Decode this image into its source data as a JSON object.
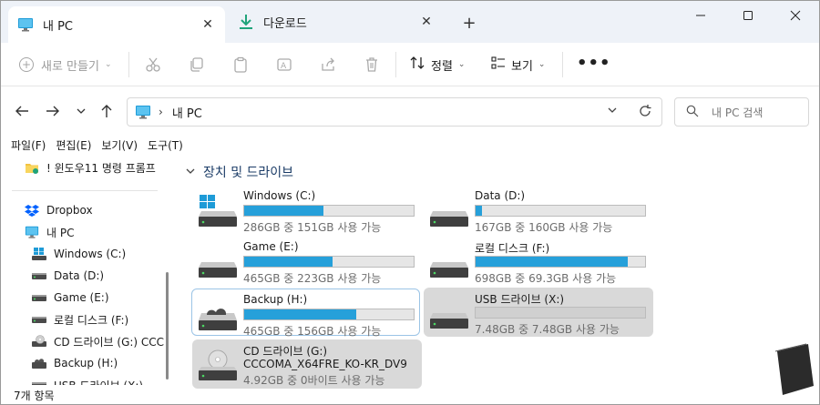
{
  "tabs": [
    {
      "label": "내 PC",
      "icon": "monitor-icon",
      "active": true
    },
    {
      "label": "다운로드",
      "icon": "download-icon",
      "active": false
    }
  ],
  "toolbar": {
    "new_label": "새로 만들기",
    "sort_label": "정렬",
    "view_label": "보기",
    "more_label": "•••"
  },
  "address": {
    "path": "내 PC",
    "separator": "›"
  },
  "search": {
    "placeholder": "내 PC 검색"
  },
  "menubar": [
    "파일(F)",
    "편집(E)",
    "보기(V)",
    "도구(T)"
  ],
  "sidebar": {
    "items": [
      {
        "label": "! 윈도우11 명령 프롬프",
        "icon": "folder-icon"
      },
      {
        "label": "Dropbox",
        "icon": "dropbox-icon"
      },
      {
        "label": "내 PC",
        "icon": "monitor-icon"
      },
      {
        "label": "Windows (C:)",
        "icon": "windows-drive-icon"
      },
      {
        "label": "Data (D:)",
        "icon": "drive-icon"
      },
      {
        "label": "Game (E:)",
        "icon": "drive-icon"
      },
      {
        "label": "로컬 디스크 (F:)",
        "icon": "drive-icon"
      },
      {
        "label": "CD 드라이브 (G:) CCC",
        "icon": "cd-drive-icon"
      },
      {
        "label": "Backup (H:)",
        "icon": "backup-drive-icon"
      },
      {
        "label": "USB 드라이브 (X:)",
        "icon": "usb-drive-icon"
      }
    ]
  },
  "section": {
    "title": "장치 및 드라이브"
  },
  "drives": [
    {
      "name": "Windows (C:)",
      "info": "286GB 중 151GB 사용 가능",
      "used_fraction": 0.47,
      "icon": "windows-drive-icon"
    },
    {
      "name": "Data (D:)",
      "info": "167GB 중 160GB 사용 가능",
      "used_fraction": 0.04,
      "icon": "drive-icon"
    },
    {
      "name": "Game (E:)",
      "info": "465GB 중 223GB 사용 가능",
      "used_fraction": 0.52,
      "icon": "drive-icon"
    },
    {
      "name": "로컬 디스크 (F:)",
      "info": "698GB 중 69.3GB 사용 가능",
      "used_fraction": 0.9,
      "icon": "drive-icon"
    },
    {
      "name": "Backup (H:)",
      "info": "465GB 중 156GB 사용 가능",
      "used_fraction": 0.66,
      "icon": "backup-drive-icon"
    },
    {
      "name": "USB 드라이브 (X:)",
      "info": "7.48GB 중 7.48GB 사용 가능",
      "used_fraction": 0.0,
      "icon": "usb-drive-icon"
    },
    {
      "name": "CD 드라이브 (G:)",
      "sub": "CCCOMA_X64FRE_KO-KR_DV9",
      "info": "4.92GB 중 0바이트 사용 가능",
      "icon": "cd-drive-icon"
    }
  ],
  "status": {
    "count": "7개 항목"
  },
  "colors": {
    "accent": "#26a0da",
    "selected": "#d9d9d9",
    "tabbar": "#eef2f8"
  }
}
